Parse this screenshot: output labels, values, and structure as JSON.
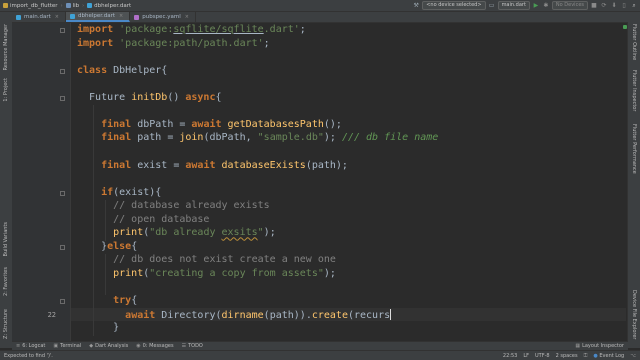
{
  "navbar": {
    "crumbs": [
      {
        "label": "import_db_flutter",
        "icon": "folder-icon"
      },
      {
        "label": "lib",
        "icon": "folder-icon"
      },
      {
        "label": "dbhelper.dart",
        "icon": "dart-file-icon"
      }
    ],
    "device_select": "<no device selected>",
    "config_select": "main.dart",
    "device_status": "No Devices"
  },
  "tabs": [
    {
      "label": "main.dart",
      "active": false
    },
    {
      "label": "dbhelper.dart",
      "active": true
    },
    {
      "label": "pubspec.yaml",
      "active": false
    }
  ],
  "left_tools": [
    "1: Project",
    "Resource Manager",
    "Z: Structure",
    "2: Favorites",
    "Build Variants"
  ],
  "right_tools": [
    "Flutter Outline",
    "Flutter Inspector",
    "Flutter Performance",
    "Device File Explorer"
  ],
  "editor": {
    "line_numbers": [
      "22"
    ],
    "current_line": "22",
    "code_lines": [
      [
        "kw:import ",
        "str:'package:",
        "strul:sqflite/sqflite",
        "str:.dart'",
        "t:;"
      ],
      [
        "kw:import ",
        "str:'package:path/path.dart'",
        "t:;"
      ],
      [],
      [
        "kw:class ",
        "t:DbHelper{"
      ],
      [],
      [
        "t:  Future ",
        "fn:initDb",
        "t:() ",
        "kw:async",
        "t:{"
      ],
      [],
      [
        "t:    ",
        "kw:final ",
        "t:dbPath = ",
        "kw:await ",
        "fn:getDatabasesPath",
        "t:();"
      ],
      [
        "t:    ",
        "kw:final ",
        "t:path = ",
        "fn:join",
        "t:(dbPath, ",
        "str:\"sample.db\"",
        "t:); ",
        "dc:/// db file name"
      ],
      [],
      [
        "t:    ",
        "kw:final ",
        "t:exist = ",
        "kw:await ",
        "fn:databaseExists",
        "t:(path);"
      ],
      [],
      [
        "t:    ",
        "kw:if",
        "t:(exist){"
      ],
      [
        "t:      ",
        "cm:// database already exists"
      ],
      [
        "t:      ",
        "cm:// open database"
      ],
      [
        "t:      ",
        "fn:print",
        "t:(",
        "str:\"db already ",
        "strw:exsits",
        "str:\"",
        "t:);"
      ],
      [
        "t:    }",
        "kw:else",
        "t:{"
      ],
      [
        "t:      ",
        "cm:// db does not exist create a new one"
      ],
      [
        "t:      ",
        "fn:print",
        "t:(",
        "str:\"creating a copy from assets\"",
        "t:);"
      ],
      [],
      [
        "t:      ",
        "kw:try",
        "t:{"
      ],
      [
        "t:        ",
        "kw:await ",
        "t:Directory(",
        "fn:dirname",
        "t:(path)).",
        "fn:create",
        "t:(recurs",
        "caret:"
      ],
      [
        "t:      }"
      ],
      [
        "t:    "
      ]
    ]
  },
  "bottom_tools": [
    {
      "label": "6: Logcat",
      "icon": "logcat-icon"
    },
    {
      "label": "Terminal",
      "icon": "terminal-icon"
    },
    {
      "label": "Dart Analysis",
      "icon": "dart-analysis-icon"
    },
    {
      "label": "0: Messages",
      "icon": "messages-icon"
    },
    {
      "label": "TODO",
      "icon": "todo-icon"
    }
  ],
  "layout_inspector": "Layout Inspector",
  "status": {
    "message": "Expected to find ')'.",
    "position": "22:53",
    "line_sep": "LF",
    "encoding": "UTF-8",
    "indent": "2 spaces",
    "event_log": "Event Log"
  },
  "colors": {
    "keyword": "#cc7832",
    "string": "#6a8759",
    "function": "#ffc66d",
    "comment": "#808080",
    "doc_comment": "#629755",
    "background": "#2b2b2b"
  }
}
